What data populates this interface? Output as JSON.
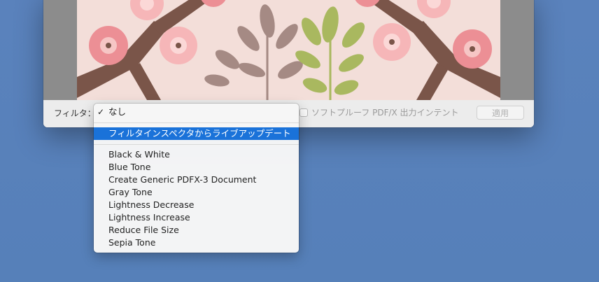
{
  "filter_bar": {
    "label": "フィルタ：",
    "softproof_label": "ソフトプルーフ PDF/X 出力インテント",
    "apply_label": "適用"
  },
  "menu": {
    "selected": "なし",
    "checkmark": "✓",
    "live_update": "フィルタインスペクタからライブアップデート",
    "filters": [
      "Black & White",
      "Blue Tone",
      "Create Generic PDFX-3 Document",
      "Gray Tone",
      "Lightness Decrease",
      "Lightness Increase",
      "Reduce File Size",
      "Sepia Tone"
    ]
  },
  "colors": {
    "desktop": "#5a82bc",
    "highlight": "#1a72d9",
    "image_background": "#f3ded9"
  }
}
